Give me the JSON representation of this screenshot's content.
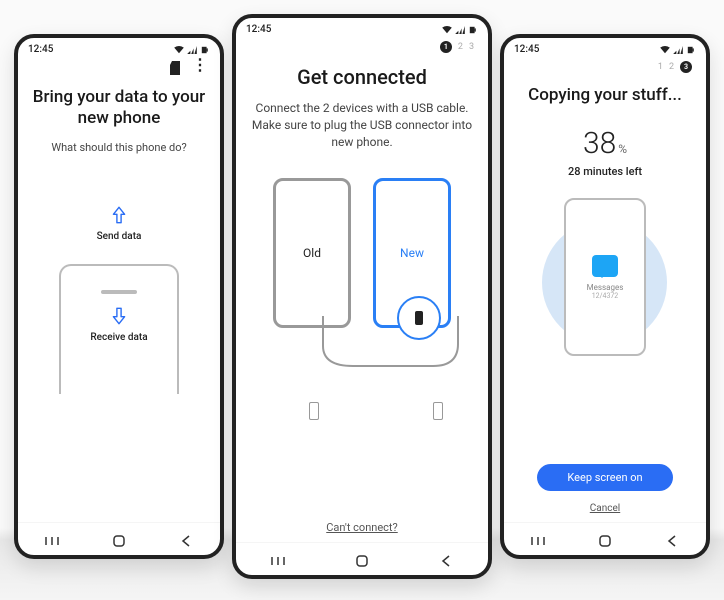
{
  "status_time": "12:45",
  "left": {
    "title": "Bring your data to your new phone",
    "subtitle": "What should this phone do?",
    "send_label": "Send data",
    "receive_label": "Receive data"
  },
  "center": {
    "steps": [
      "1",
      "2",
      "3"
    ],
    "active_step": 1,
    "title": "Get connected",
    "subtitle": "Connect the 2 devices with a USB cable. Make sure to plug the USB connector into new phone.",
    "old_label": "Old",
    "new_label": "New",
    "cant_connect": "Can't connect?"
  },
  "right": {
    "steps": [
      "1",
      "2",
      "3"
    ],
    "active_step": 3,
    "title": "Copying your stuff...",
    "percent": "38",
    "percent_symbol": "%",
    "time_left": "28 minutes left",
    "item_label": "Messages",
    "item_count": "12/4372",
    "button": "Keep screen on",
    "cancel": "Cancel"
  }
}
